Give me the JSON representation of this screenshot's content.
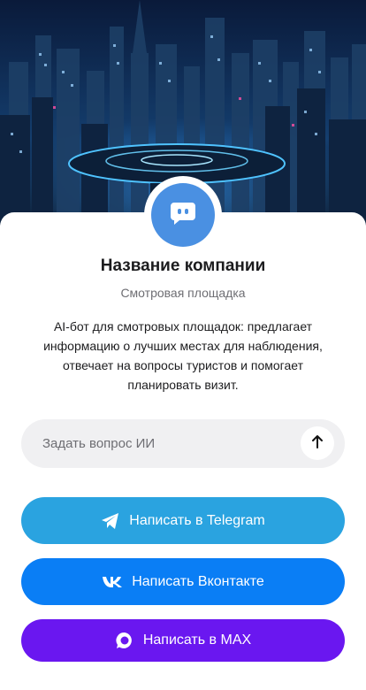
{
  "profile": {
    "name": "Название компании",
    "category": "Смотровая площадка",
    "description": "AI-бот для смотровых площадок: предлагает информацию о лучших местах для наблюдения, отвечает на вопросы туристов и помогает планировать визит."
  },
  "ask": {
    "placeholder": "Задать вопрос ИИ",
    "value": ""
  },
  "buttons": {
    "telegram": {
      "label": "Написать в Telegram",
      "color": "#2aa3e0",
      "icon": "telegram-icon"
    },
    "vk": {
      "label": "Написать Вконтакте",
      "color": "#0a7ef5",
      "icon": "vk-icon"
    },
    "max": {
      "label": "Написать в MAX",
      "color": "#6a17f0",
      "icon": "max-icon"
    }
  },
  "colors": {
    "avatar": "#4a90e2",
    "card": "#ffffff",
    "input_bg": "#f0f0f2"
  }
}
